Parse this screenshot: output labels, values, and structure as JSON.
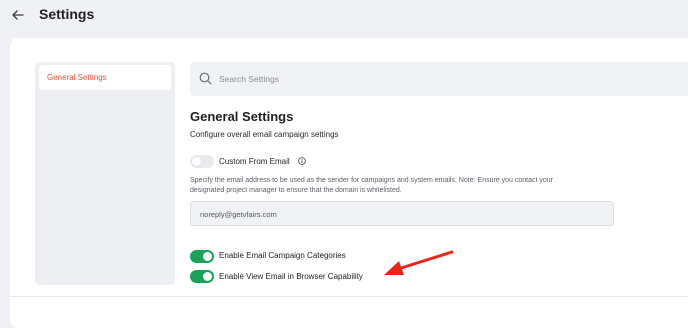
{
  "header": {
    "title": "Settings"
  },
  "sidebar": {
    "items": [
      {
        "label": "General Settings",
        "active": true
      }
    ]
  },
  "search": {
    "placeholder": "Search Settings"
  },
  "section": {
    "title": "General Settings",
    "subtitle": "Configure overall email campaign settings"
  },
  "settings": {
    "custom_from_email": {
      "label": "Custom From Email",
      "enabled": false
    },
    "help_line1": "Specify the email address to be used as the sender for campaigns and system emails. Note: Ensure you contact your",
    "help_line2": "designated project manager to ensure that the domain is whitelisted.",
    "email_value": "noreply@getvfairs.com",
    "email_campaign_categories": {
      "label": "Enable Email Campaign Categories",
      "enabled": true
    },
    "view_email_in_browser": {
      "label": "Enable View Email in Browser Capability",
      "enabled": true
    }
  },
  "colors": {
    "accent": "#e8533a",
    "toggle_on": "#1aa25b",
    "annotation_arrow": "#e8261a"
  },
  "icons": [
    "back-arrow-icon",
    "search-icon",
    "info-icon",
    "annotation-arrow-icon"
  ]
}
